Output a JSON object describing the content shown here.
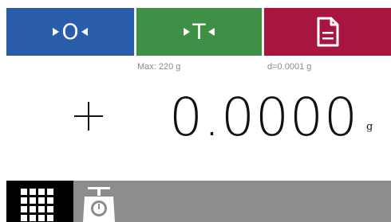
{
  "toolbar": {
    "zero_button": {
      "letter": "O",
      "icon": "zero-arrows-icon"
    },
    "tare_button": {
      "letter": "T",
      "icon": "tare-arrows-icon"
    },
    "print_button": {
      "icon": "document-icon"
    }
  },
  "info": {
    "max_capacity": "Max: 220 g",
    "resolution": "d=0.0001 g"
  },
  "display": {
    "sign": "+",
    "value": "0.0000",
    "unit": "g"
  },
  "bottom_bar": {
    "menu_icon": "grid-menu-icon",
    "profile_icon": "scale-icon"
  },
  "colors": {
    "zero": "#2a5cac",
    "tare": "#3f8f47",
    "print": "#a8163f",
    "bottom_bar": "#8c8c8c"
  }
}
